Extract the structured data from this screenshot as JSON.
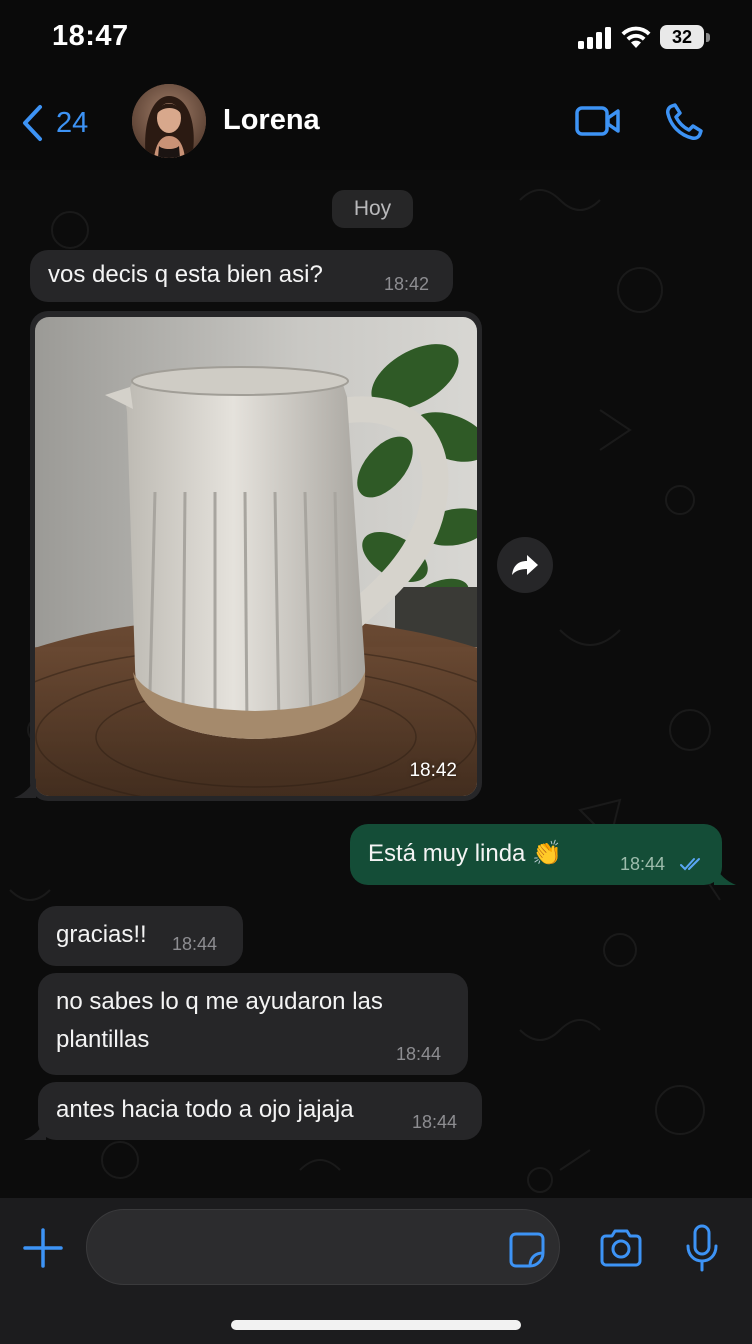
{
  "status_bar": {
    "time": "18:47",
    "battery": "32"
  },
  "header": {
    "back_count": "24",
    "contact_name": "Lorena"
  },
  "chat": {
    "day_label": "Hoy",
    "messages": [
      {
        "direction": "in",
        "text": "vos decis q esta bien asi?",
        "time": "18:42"
      },
      {
        "direction": "in",
        "type": "image",
        "image_desc": "white ceramic pitcher",
        "time": "18:42"
      },
      {
        "direction": "out",
        "text": "Está muy linda 👏",
        "time": "18:44",
        "status": "read"
      },
      {
        "direction": "in",
        "text": "gracias!!",
        "time": "18:44"
      },
      {
        "direction": "in",
        "text": "no sabes lo q me ayudaron las plantillas",
        "time": "18:44"
      },
      {
        "direction": "in",
        "text": "antes hacia todo a ojo jajaja",
        "time": "18:44"
      }
    ]
  },
  "input": {
    "value": "",
    "placeholder": ""
  },
  "colors": {
    "accent": "#3d93f5",
    "outgoing_bubble": "#144d37",
    "incoming_bubble": "#262628",
    "read_ticks": "#5aa6f5"
  },
  "icons": [
    "chevron-left-icon",
    "video-call-icon",
    "phone-icon",
    "forward-icon",
    "plus-icon",
    "sticker-icon",
    "camera-icon",
    "microphone-icon",
    "double-check-icon"
  ]
}
